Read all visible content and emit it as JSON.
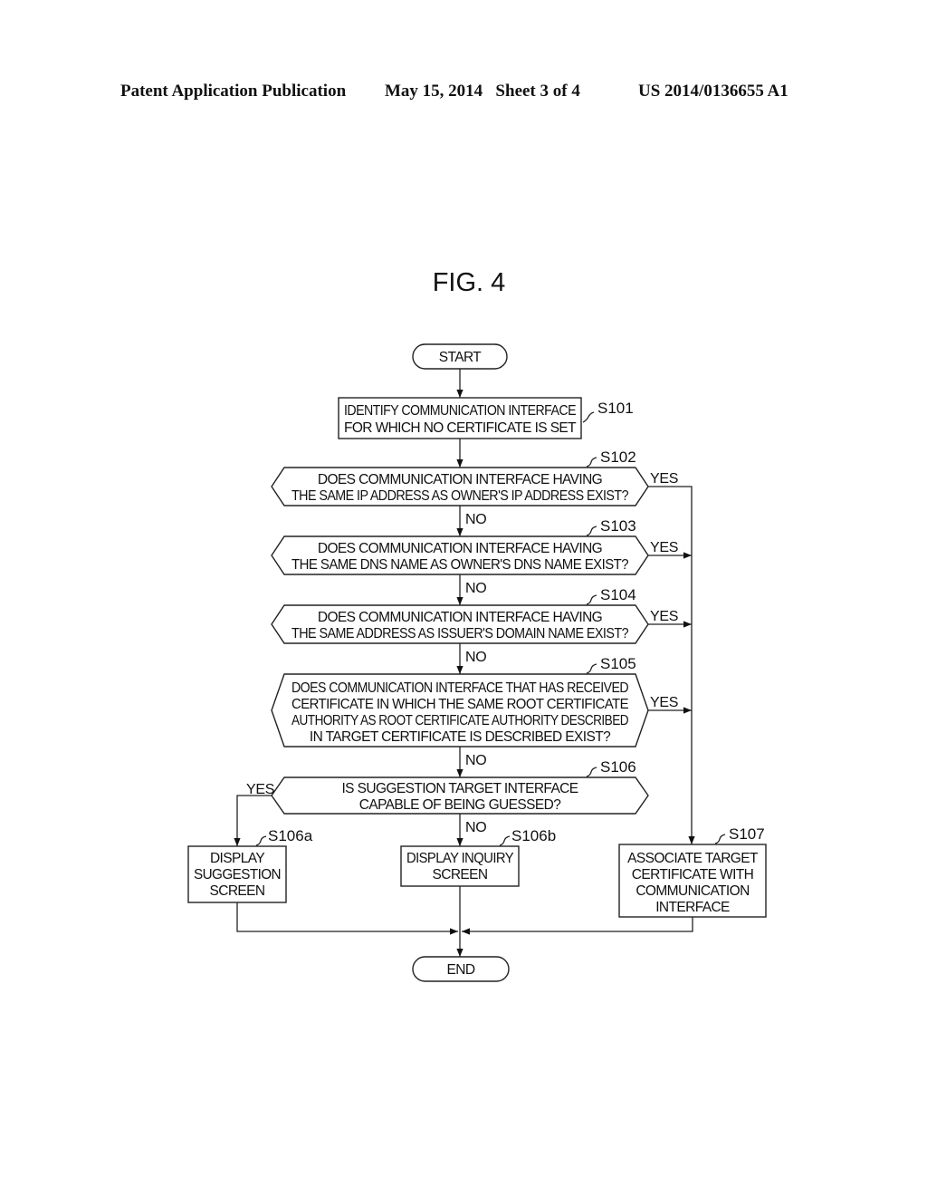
{
  "header": {
    "publication_type": "Patent Application Publication",
    "date_sheet": "May 15, 2014   Sheet 3 of 4",
    "publication_number": "US 2014/0136655 A1"
  },
  "figure": {
    "title": "FIG. 4"
  },
  "flowchart": {
    "start": "START",
    "end": "END",
    "steps": {
      "s101": {
        "id": "S101",
        "lines": [
          "IDENTIFY COMMUNICATION INTERFACE",
          "FOR WHICH NO CERTIFICATE IS SET"
        ]
      },
      "s102": {
        "id": "S102",
        "lines": [
          "DOES COMMUNICATION INTERFACE HAVING",
          "THE SAME IP ADDRESS AS OWNER'S IP ADDRESS EXIST?"
        ]
      },
      "s103": {
        "id": "S103",
        "lines": [
          "DOES COMMUNICATION INTERFACE HAVING",
          "THE SAME DNS NAME AS OWNER'S DNS NAME EXIST?"
        ]
      },
      "s104": {
        "id": "S104",
        "lines": [
          "DOES COMMUNICATION INTERFACE HAVING",
          "THE SAME ADDRESS AS ISSUER'S DOMAIN NAME EXIST?"
        ]
      },
      "s105": {
        "id": "S105",
        "lines": [
          "DOES COMMUNICATION INTERFACE THAT HAS RECEIVED",
          "CERTIFICATE IN WHICH THE SAME ROOT CERTIFICATE",
          "AUTHORITY AS ROOT CERTIFICATE AUTHORITY DESCRIBED",
          "IN TARGET CERTIFICATE IS DESCRIBED EXIST?"
        ]
      },
      "s106": {
        "id": "S106",
        "lines": [
          "IS SUGGESTION TARGET INTERFACE",
          "CAPABLE OF BEING GUESSED?"
        ]
      },
      "s106a": {
        "id": "S106a",
        "lines": [
          "DISPLAY",
          "SUGGESTION",
          "SCREEN"
        ]
      },
      "s106b": {
        "id": "S106b",
        "lines": [
          "DISPLAY INQUIRY",
          "SCREEN"
        ]
      },
      "s107": {
        "id": "S107",
        "lines": [
          "ASSOCIATE TARGET",
          "CERTIFICATE WITH",
          "COMMUNICATION",
          "INTERFACE"
        ]
      }
    },
    "labels": {
      "yes": "YES",
      "no": "NO"
    }
  }
}
